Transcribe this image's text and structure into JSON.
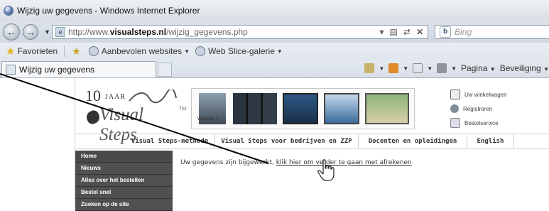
{
  "window": {
    "title": "Wijzig uw gegevens - Windows Internet Explorer"
  },
  "navbar": {
    "url_prefix": "http://www.",
    "url_domain": "visualsteps.nl",
    "url_path": "/wijzig_gegevens.php",
    "search_placeholder": "Bing"
  },
  "favorites_bar": {
    "favorites_label": "Favorieten",
    "suggested_sites_label": "Aanbevolen websites",
    "web_slice_label": "Web Slice-galerie"
  },
  "tab": {
    "title": "Wijzig uw gegevens"
  },
  "command_bar": {
    "page_label": "Pagina",
    "safety_label": "Beveiliging"
  },
  "site": {
    "logo": {
      "ten": "10",
      "jaar": "JAAR",
      "name": "Visual Steps",
      "tm": "TM"
    },
    "banner": {
      "win7_label": "Windows 7"
    },
    "top_links": [
      {
        "label": "Uw winkelwagen",
        "icon": "cart-icon"
      },
      {
        "label": "Registreren",
        "icon": "register-icon"
      },
      {
        "label": "Bestelservice",
        "icon": "order-service-icon"
      }
    ],
    "main_nav": [
      "Visual Steps-methode",
      "Visual Steps voor bedrijven en ZZP",
      "Docenten en opleidingen",
      "English"
    ],
    "side_nav": [
      "Home",
      "Nieuws",
      "Alles over het bestellen",
      "Bestel snel",
      "Zoeken op de site"
    ],
    "message": {
      "text": "Uw gegevens zijn bijgewerkt",
      "link": "klik hier om verder te gaan met afrekenen"
    }
  }
}
